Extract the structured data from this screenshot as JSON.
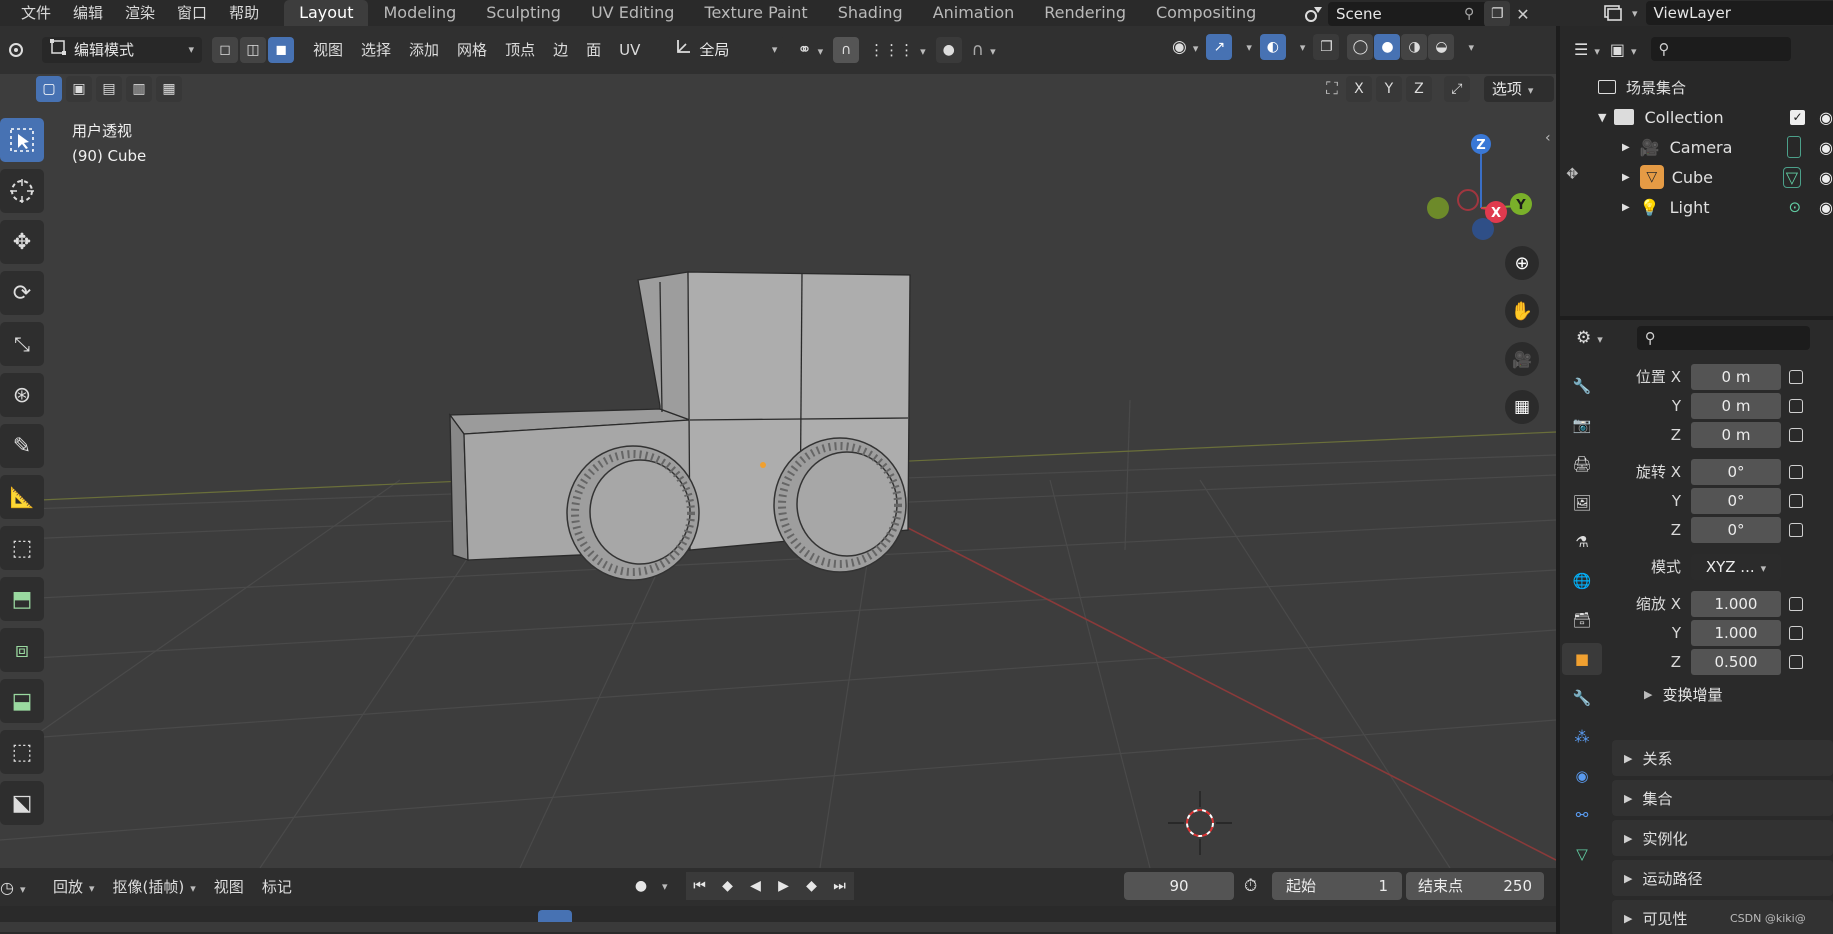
{
  "menus": [
    "文件",
    "编辑",
    "渲染",
    "窗口",
    "帮助"
  ],
  "workspace_tabs": [
    "Layout",
    "Modeling",
    "Sculpting",
    "UV Editing",
    "Texture Paint",
    "Shading",
    "Animation",
    "Rendering",
    "Compositing"
  ],
  "active_tab": "Layout",
  "scene": "Scene",
  "view_layer": "ViewLayer",
  "viewport_header": {
    "mode": "编辑模式",
    "menus": [
      "视图",
      "选择",
      "添加",
      "网格",
      "顶点",
      "边",
      "面",
      "UV"
    ],
    "transform_orientation": "全局",
    "axes": [
      "X",
      "Y",
      "Z"
    ],
    "options": "选项"
  },
  "viewport": {
    "view_name": "用户透视",
    "object_info": "(90) Cube",
    "gizmo_axes": {
      "x": "X",
      "y": "Y",
      "z": "Z"
    }
  },
  "outliner": {
    "root": "场景集合",
    "collection": "Collection",
    "objects": [
      "Camera",
      "Cube",
      "Light"
    ]
  },
  "properties": {
    "location": {
      "label": "位置",
      "x": "0 m",
      "y": "0 m",
      "z": "0 m"
    },
    "rotation": {
      "label": "旋转",
      "x": "0°",
      "y": "0°",
      "z": "0°"
    },
    "mode": {
      "label": "模式",
      "value": "XYZ ..."
    },
    "scale": {
      "label": "缩放",
      "x": "1.000",
      "y": "1.000",
      "z": "0.500"
    },
    "axis_letters": {
      "x": "X",
      "y": "Y",
      "z": "Z"
    },
    "delta": "变换增量",
    "sections": [
      "关系",
      "集合",
      "实例化",
      "运动路径",
      "可见性"
    ]
  },
  "timeline": {
    "playback": "回放",
    "keying": "抠像(插帧)",
    "view": "视图",
    "marker": "标记",
    "current_frame": "90",
    "start_label": "起始",
    "start": "1",
    "end_label": "结束点",
    "end": "250"
  },
  "watermark": "CSDN @kiki@"
}
